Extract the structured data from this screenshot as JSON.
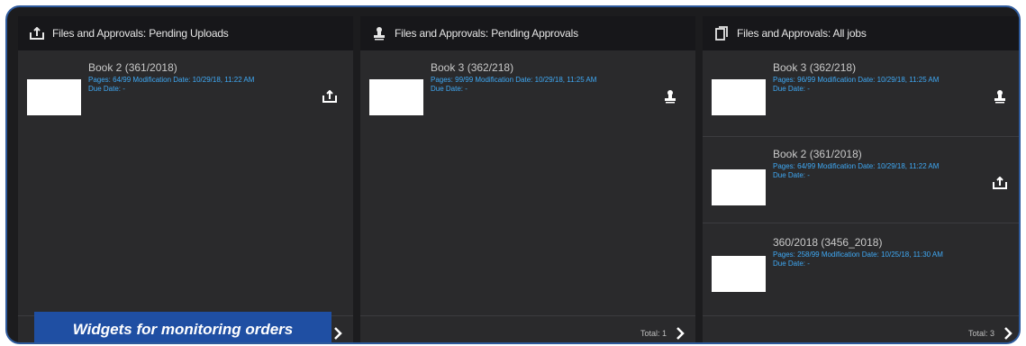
{
  "colors": {
    "accent": "#3fa9f5",
    "banner": "#1f4fa3",
    "frame": "#2e5a9c"
  },
  "panels": [
    {
      "title": "Files and Approvals: Pending Uploads",
      "icon": "upload-icon",
      "items": [
        {
          "title": "Book 2 (361/2018)",
          "meta1": "Pages: 64/99 Modification Date: 10/29/18, 11:22 AM",
          "meta2": "Due Date: -",
          "icon": "upload-icon"
        }
      ],
      "footer": ""
    },
    {
      "title": "Files and Approvals: Pending Approvals",
      "icon": "approval-stamp-icon",
      "items": [
        {
          "title": "Book 3 (362/218)",
          "meta1": "Pages: 99/99 Modification Date: 10/29/18, 11:25 AM",
          "meta2": "Due Date: -",
          "icon": "approval-stamp-icon"
        }
      ],
      "footer": "Total: 1"
    },
    {
      "title": "Files and Approvals: All jobs",
      "icon": "jobs-icon",
      "items": [
        {
          "title": "Book 3 (362/218)",
          "meta1": "Pages: 96/99 Modification Date: 10/29/18, 11:25 AM",
          "meta2": "Due Date: -",
          "icon": "approval-stamp-icon"
        },
        {
          "title": "Book 2 (361/2018)",
          "meta1": "Pages: 64/99 Modification Date: 10/29/18, 11:22 AM",
          "meta2": "Due Date: -",
          "icon": "upload-icon"
        },
        {
          "title": "360/2018 (3456_2018)",
          "meta1": "Pages: 258/99 Modification Date: 10/25/18, 11:30 AM",
          "meta2": "Due Date: -",
          "icon": ""
        }
      ],
      "footer": "Total: 3"
    }
  ],
  "banner": {
    "text": "Widgets for monitoring orders"
  }
}
